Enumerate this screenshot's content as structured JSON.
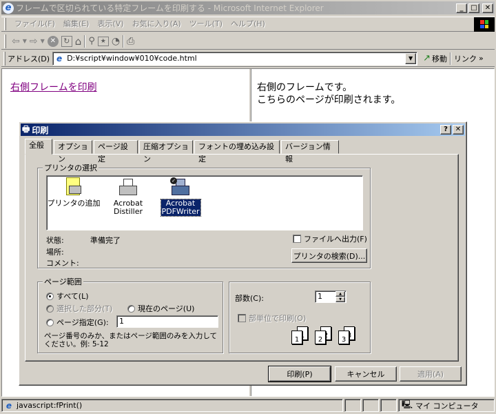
{
  "browser": {
    "title": "フレームで区切られている特定フレームを印刷する - Microsoft Internet Explorer",
    "menu": [
      "ファイル(F)",
      "編集(E)",
      "表示(V)",
      "お気に入り(A)",
      "ツール(T)",
      "ヘルプ(H)"
    ],
    "address_label": "アドレス(D)",
    "address_value": "D:¥script¥window¥010¥code.html",
    "go_label": "移動",
    "links_label": "リンク",
    "status_text": "javascript:fPrint()",
    "zone_text": "マイ コンピュータ"
  },
  "content": {
    "left_link": "右側フレームを印刷",
    "right_line1": "右側のフレームです。",
    "right_line2": "こちらのページが印刷されます。"
  },
  "dialog": {
    "title": "印刷",
    "tabs": [
      "全般",
      "オプション",
      "ページ設定",
      "圧縮オプション",
      "フォントの埋め込み設定",
      "バージョン情報"
    ],
    "printer_group": {
      "label": "プリンタの選択",
      "printers": [
        {
          "name": "プリンタの追加",
          "icon": "add-printer-icon",
          "selected": false
        },
        {
          "name": "Acrobat\nDistiller",
          "icon": "printer-icon",
          "selected": false
        },
        {
          "name": "Acrobat\nPDFWriter",
          "icon": "default-printer-icon",
          "selected": true
        }
      ],
      "status_label": "状態:",
      "status_value": "準備完了",
      "location_label": "場所:",
      "comment_label": "コメント:",
      "print_to_file_label": "ファイルへ出力(F)",
      "find_printer_label": "プリンタの検索(D)..."
    },
    "page_range": {
      "label": "ページ範囲",
      "all_label": "すべて(L)",
      "selection_label": "選択した部分(T)",
      "current_label": "現在のページ(U)",
      "pages_label": "ページ指定(G):",
      "pages_value": "1",
      "hint": "ページ番号のみか、またはページ範囲のみを入力して\nください。例: 5-12"
    },
    "copies": {
      "label": "部数(C):",
      "value": "1",
      "collate_label": "部単位で印刷(O)",
      "collate_pages": [
        "1",
        "1",
        "2",
        "2",
        "3",
        "3"
      ]
    },
    "buttons": {
      "print": "印刷(P)",
      "cancel": "キャンセル",
      "apply": "適用(A)"
    }
  }
}
